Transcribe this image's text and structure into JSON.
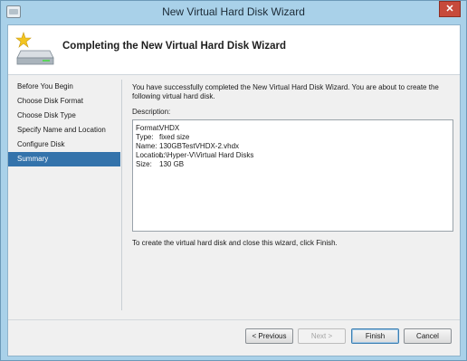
{
  "window": {
    "title": "New Virtual Hard Disk Wizard",
    "close_label": "✕"
  },
  "header": {
    "title": "Completing the New Virtual Hard Disk Wizard",
    "icon": "disk-with-star-icon"
  },
  "nav": {
    "items": [
      {
        "label": "Before You Begin"
      },
      {
        "label": "Choose Disk Format"
      },
      {
        "label": "Choose Disk Type"
      },
      {
        "label": "Specify Name and Location"
      },
      {
        "label": "Configure Disk"
      },
      {
        "label": "Summary"
      }
    ],
    "selected": "Summary"
  },
  "content": {
    "intro_line1": "You have successfully completed the New Virtual Hard Disk Wizard. You are about to create the",
    "intro_line2": "following virtual hard disk.",
    "description_label": "Description:",
    "description": [
      {
        "key": "Format:",
        "value": "VHDX"
      },
      {
        "key": "Type:",
        "value": "fixed size"
      },
      {
        "key": "Name:",
        "value": "130GBTestVHDX-2.vhdx"
      },
      {
        "key": "Location:",
        "value": "L:\\Hyper-V\\Virtual Hard Disks"
      },
      {
        "key": "Size:",
        "value": "130 GB"
      }
    ],
    "finish_text": "To create the virtual hard disk and close this wizard, click Finish."
  },
  "buttons": {
    "previous": "< Previous",
    "next": "Next >",
    "finish": "Finish",
    "cancel": "Cancel"
  },
  "colors": {
    "selection": "#3473ab",
    "title_bar": "#a9d1e9",
    "close_button": "#c74a3b"
  }
}
